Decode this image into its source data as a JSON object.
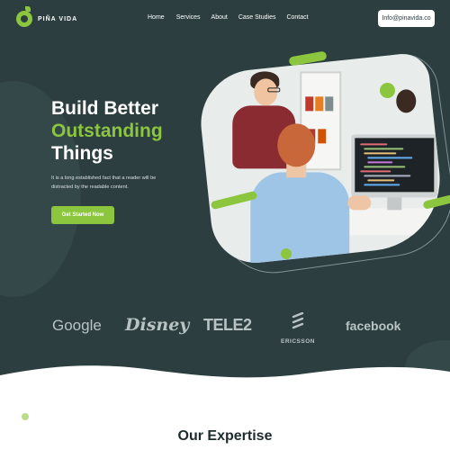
{
  "nav": {
    "brand": "PIÑA VIDA",
    "links": [
      "Home",
      "Services",
      "About",
      "Case Studies",
      "Contact"
    ],
    "email": "Info@pinavida.co"
  },
  "hero": {
    "line1": "Build Better",
    "line2": "Outstanding",
    "line3": "Things",
    "description": "It is a long established fact that a reader will be distracted by the readable content.",
    "cta": "Get Started Now"
  },
  "brands": [
    "Google",
    "Disney",
    "TELE2",
    "ERICSSON",
    "facebook"
  ],
  "expertise": {
    "title": "Our Expertise"
  },
  "colors": {
    "primary": "#2c3e40",
    "accent": "#8cc63f",
    "brand_logos": "#b9c3c4"
  }
}
